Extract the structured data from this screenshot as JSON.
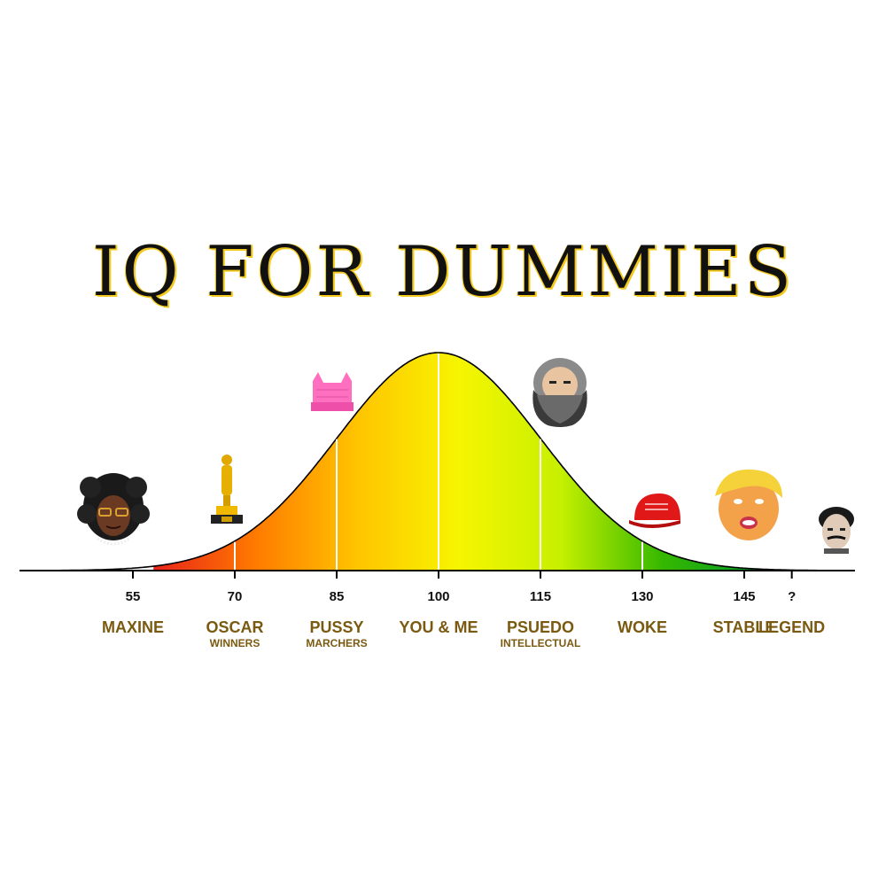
{
  "title": "IQ FOR DUMMIES",
  "chart_data": {
    "type": "area",
    "title": "IQ FOR DUMMIES",
    "distribution": {
      "mean": 100,
      "sd": 15
    },
    "xlim": [
      40,
      155
    ],
    "ticks": [
      {
        "x": 55,
        "label": "55",
        "category": "MAXINE",
        "sub": ""
      },
      {
        "x": 70,
        "label": "70",
        "category": "OSCAR",
        "sub": "WINNERS"
      },
      {
        "x": 85,
        "label": "85",
        "category": "PUSSY",
        "sub": "MARCHERS"
      },
      {
        "x": 100,
        "label": "100",
        "category": "YOU & ME",
        "sub": ""
      },
      {
        "x": 115,
        "label": "115",
        "category": "PSUEDO",
        "sub": "INTELLECTUAL"
      },
      {
        "x": 130,
        "label": "130",
        "category": "WOKE",
        "sub": ""
      },
      {
        "x": 145,
        "label": "145",
        "category": "STABLE",
        "sub": ""
      },
      {
        "x": 152,
        "label": "?",
        "category": "LEGEND",
        "sub": ""
      }
    ],
    "gradient_colors": [
      "#e8231a",
      "#ff7a00",
      "#ffc400",
      "#f7f500",
      "#c6f000",
      "#35b800",
      "#009a2a"
    ],
    "icons": [
      "caricature-woman-icon",
      "oscar-statuette-icon",
      "pink-hat-icon",
      "bearded-man-icon",
      "red-cap-icon",
      "caricature-man-icon",
      "mustache-man-icon"
    ]
  }
}
